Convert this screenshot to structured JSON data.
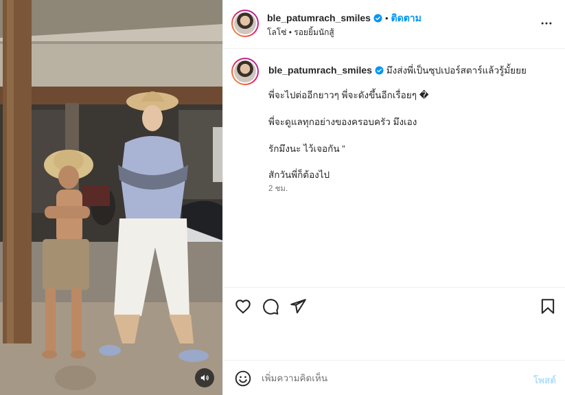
{
  "header": {
    "username": "ble_patumrach_smiles",
    "verified_icon": "verified-badge-icon",
    "separator": "•",
    "follow_label": "ติดตาม",
    "subline": "โลโซ่ • รอยยิ้มนักสู้",
    "more_icon": "more-options-icon"
  },
  "caption": {
    "username": "ble_patumrach_smiles",
    "first_line": "มึงส่งพี่เป็นซุปเปอร์สตาร์แล้วรู้มั้ยยย",
    "lines": [
      "พี่จะไปต่ออีกยาวๆ พี่จะดังขึ้นอีกเรื่อยๆ �",
      "พี่จะดูแลทุกอย่างของครอบครัว มึงเอง",
      "รักมึงนะ ไว้เจอกัน “",
      "สักวันพี่ก็ต้องไป"
    ],
    "timestamp": "2 ชม."
  },
  "actions": {
    "like_icon": "heart-icon",
    "comment_icon": "comment-icon",
    "share_icon": "share-icon",
    "save_icon": "bookmark-icon"
  },
  "comment": {
    "emoji_icon": "emoji-icon",
    "placeholder": "เพิ่มความคิดเห็น",
    "post_label": "โพสต์"
  },
  "media": {
    "sound_icon": "speaker-icon"
  },
  "colors": {
    "accent": "#0095f6",
    "post_disabled": "#b2dffc",
    "verified": "#0095f6",
    "muted_text": "#737373",
    "divider": "#efefef"
  }
}
